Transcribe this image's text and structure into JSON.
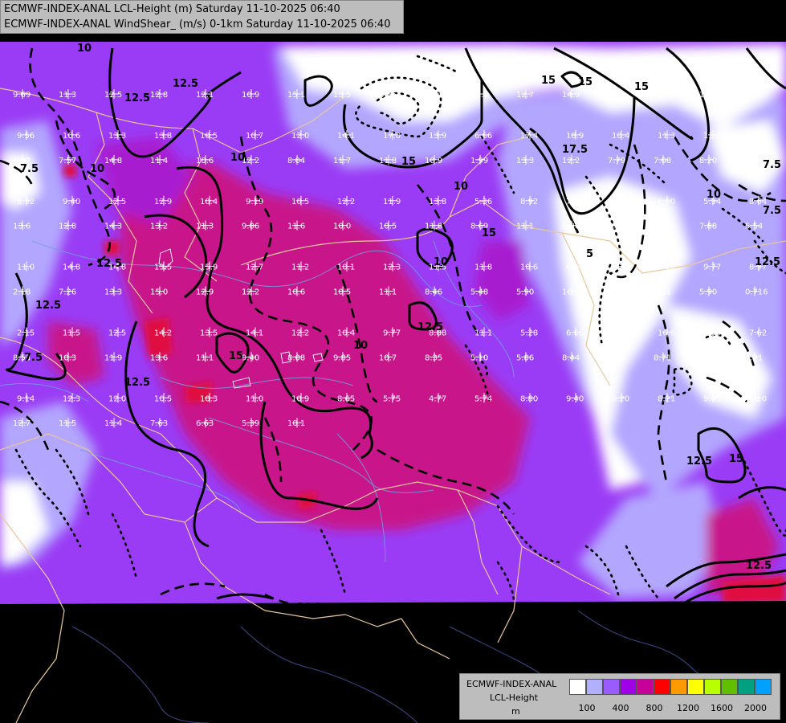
{
  "title": {
    "line1": "ECMWF-INDEX-ANAL LCL-Height (m) Saturday 11-10-2025 06:40",
    "line2": "ECMWF-INDEX-ANAL WindShear_ (m/s) 0-1km Saturday 11-10-2025 06:40"
  },
  "legend": {
    "line1": "ECMWF-INDEX-ANAL",
    "line2": "LCL-Height",
    "line3": "m",
    "colors": [
      "#ffffff",
      "#b0b0ff",
      "#9a5cff",
      "#a000e8",
      "#c8009a",
      "#ff0000",
      "#ff9a00",
      "#ffff00",
      "#b8ff00",
      "#60c000",
      "#00a080",
      "#00a0ff"
    ],
    "ticks": [
      "100",
      "400",
      "800",
      "1200",
      "1600",
      "2000"
    ]
  },
  "contour_labels": [
    "10",
    "12.5",
    "12.5",
    "10",
    "7.5",
    "15",
    "17.5",
    "15",
    "15",
    "12.5",
    "10",
    "7.5",
    "15",
    "12.5",
    "15",
    "10",
    "12.5",
    "7.5",
    "15",
    "10",
    "12.5",
    "10",
    "12.5",
    "15",
    "12.5",
    "10",
    "5",
    "7.5",
    "10",
    "12.5"
  ],
  "values": [
    "9.69",
    "11.3",
    "12.5",
    "12.8",
    "12.1",
    "10.9",
    "15.1",
    "13.5",
    "8.55",
    "17.1",
    "13.0",
    "12.7",
    "14.9",
    "16.4",
    "13.1",
    "12.5",
    "8.30",
    "9.56",
    "10.6",
    "13.3",
    "13.8",
    "10.5",
    "10.7",
    "12.0",
    "14.1",
    "17.0",
    "13.9",
    "6.66",
    "17.4",
    "18.9",
    "10.4",
    "11.3",
    "13.2",
    "12.4",
    "6.82",
    "7.57",
    "14.8",
    "11.4",
    "10.6",
    "12.2",
    "8.04",
    "11.7",
    "11.8",
    "10.9",
    "1.99",
    "13.3",
    "12.2",
    "7.79",
    "7.08",
    "8.20",
    "9.81",
    "8.92",
    "9.40",
    "12.5",
    "12.9",
    "10.4",
    "9.19",
    "10.5",
    "12.2",
    "11.9",
    "13.8",
    "5.36",
    "8.92",
    "7.84",
    "5.76",
    "6.90",
    "5.94",
    "8.64",
    "13.6",
    "12.8",
    "14.3",
    "13.2",
    "11.3",
    "9.86",
    "11.6",
    "10.0",
    "10.5",
    "11.8",
    "8.69",
    "11.1",
    "5.80",
    "5.15",
    "6.28",
    "7.88",
    "5.54",
    "11.0",
    "14.8",
    "14.8",
    "13.5",
    "15.9",
    "12.7",
    "11.2",
    "10.1",
    "12.3",
    "11.5",
    "11.8",
    "10.6",
    "6.50",
    "5.21",
    "9.62",
    "9.77",
    "8.97",
    "2.18",
    "7.26",
    "13.3",
    "15.0",
    "12.9",
    "12.2",
    "10.6",
    "10.5",
    "11.1",
    "8.46",
    "5.48",
    "5.90",
    "10.1",
    "11.5",
    "11.1",
    "5.90",
    "0.716",
    "2.15",
    "11.5",
    "12.5",
    "14.2",
    "13.5",
    "14.1",
    "12.2",
    "10.4",
    "9.77",
    "8.88",
    "11.1",
    "5.28",
    "6.66",
    "10.0",
    "16.6",
    "0.996",
    "7.62",
    "8.53",
    "10.3",
    "11.9",
    "13.6",
    "11.1",
    "9.40",
    "8.08",
    "9.85",
    "10.7",
    "8.35",
    "5.10",
    "5.86",
    "8.44",
    "9.69",
    "8.71",
    "9.53",
    "7.91",
    "9.14",
    "12.3",
    "12.0",
    "10.5",
    "10.3",
    "11.0",
    "10.9",
    "8.65",
    "5.75",
    "4.77",
    "5.74",
    "8.80",
    "9.40",
    "9.20",
    "8.21",
    "9.49",
    "10.0",
    "12.7",
    "11.5",
    "11.4",
    "7.63",
    "6.63",
    "5.39",
    "10.1"
  ]
}
